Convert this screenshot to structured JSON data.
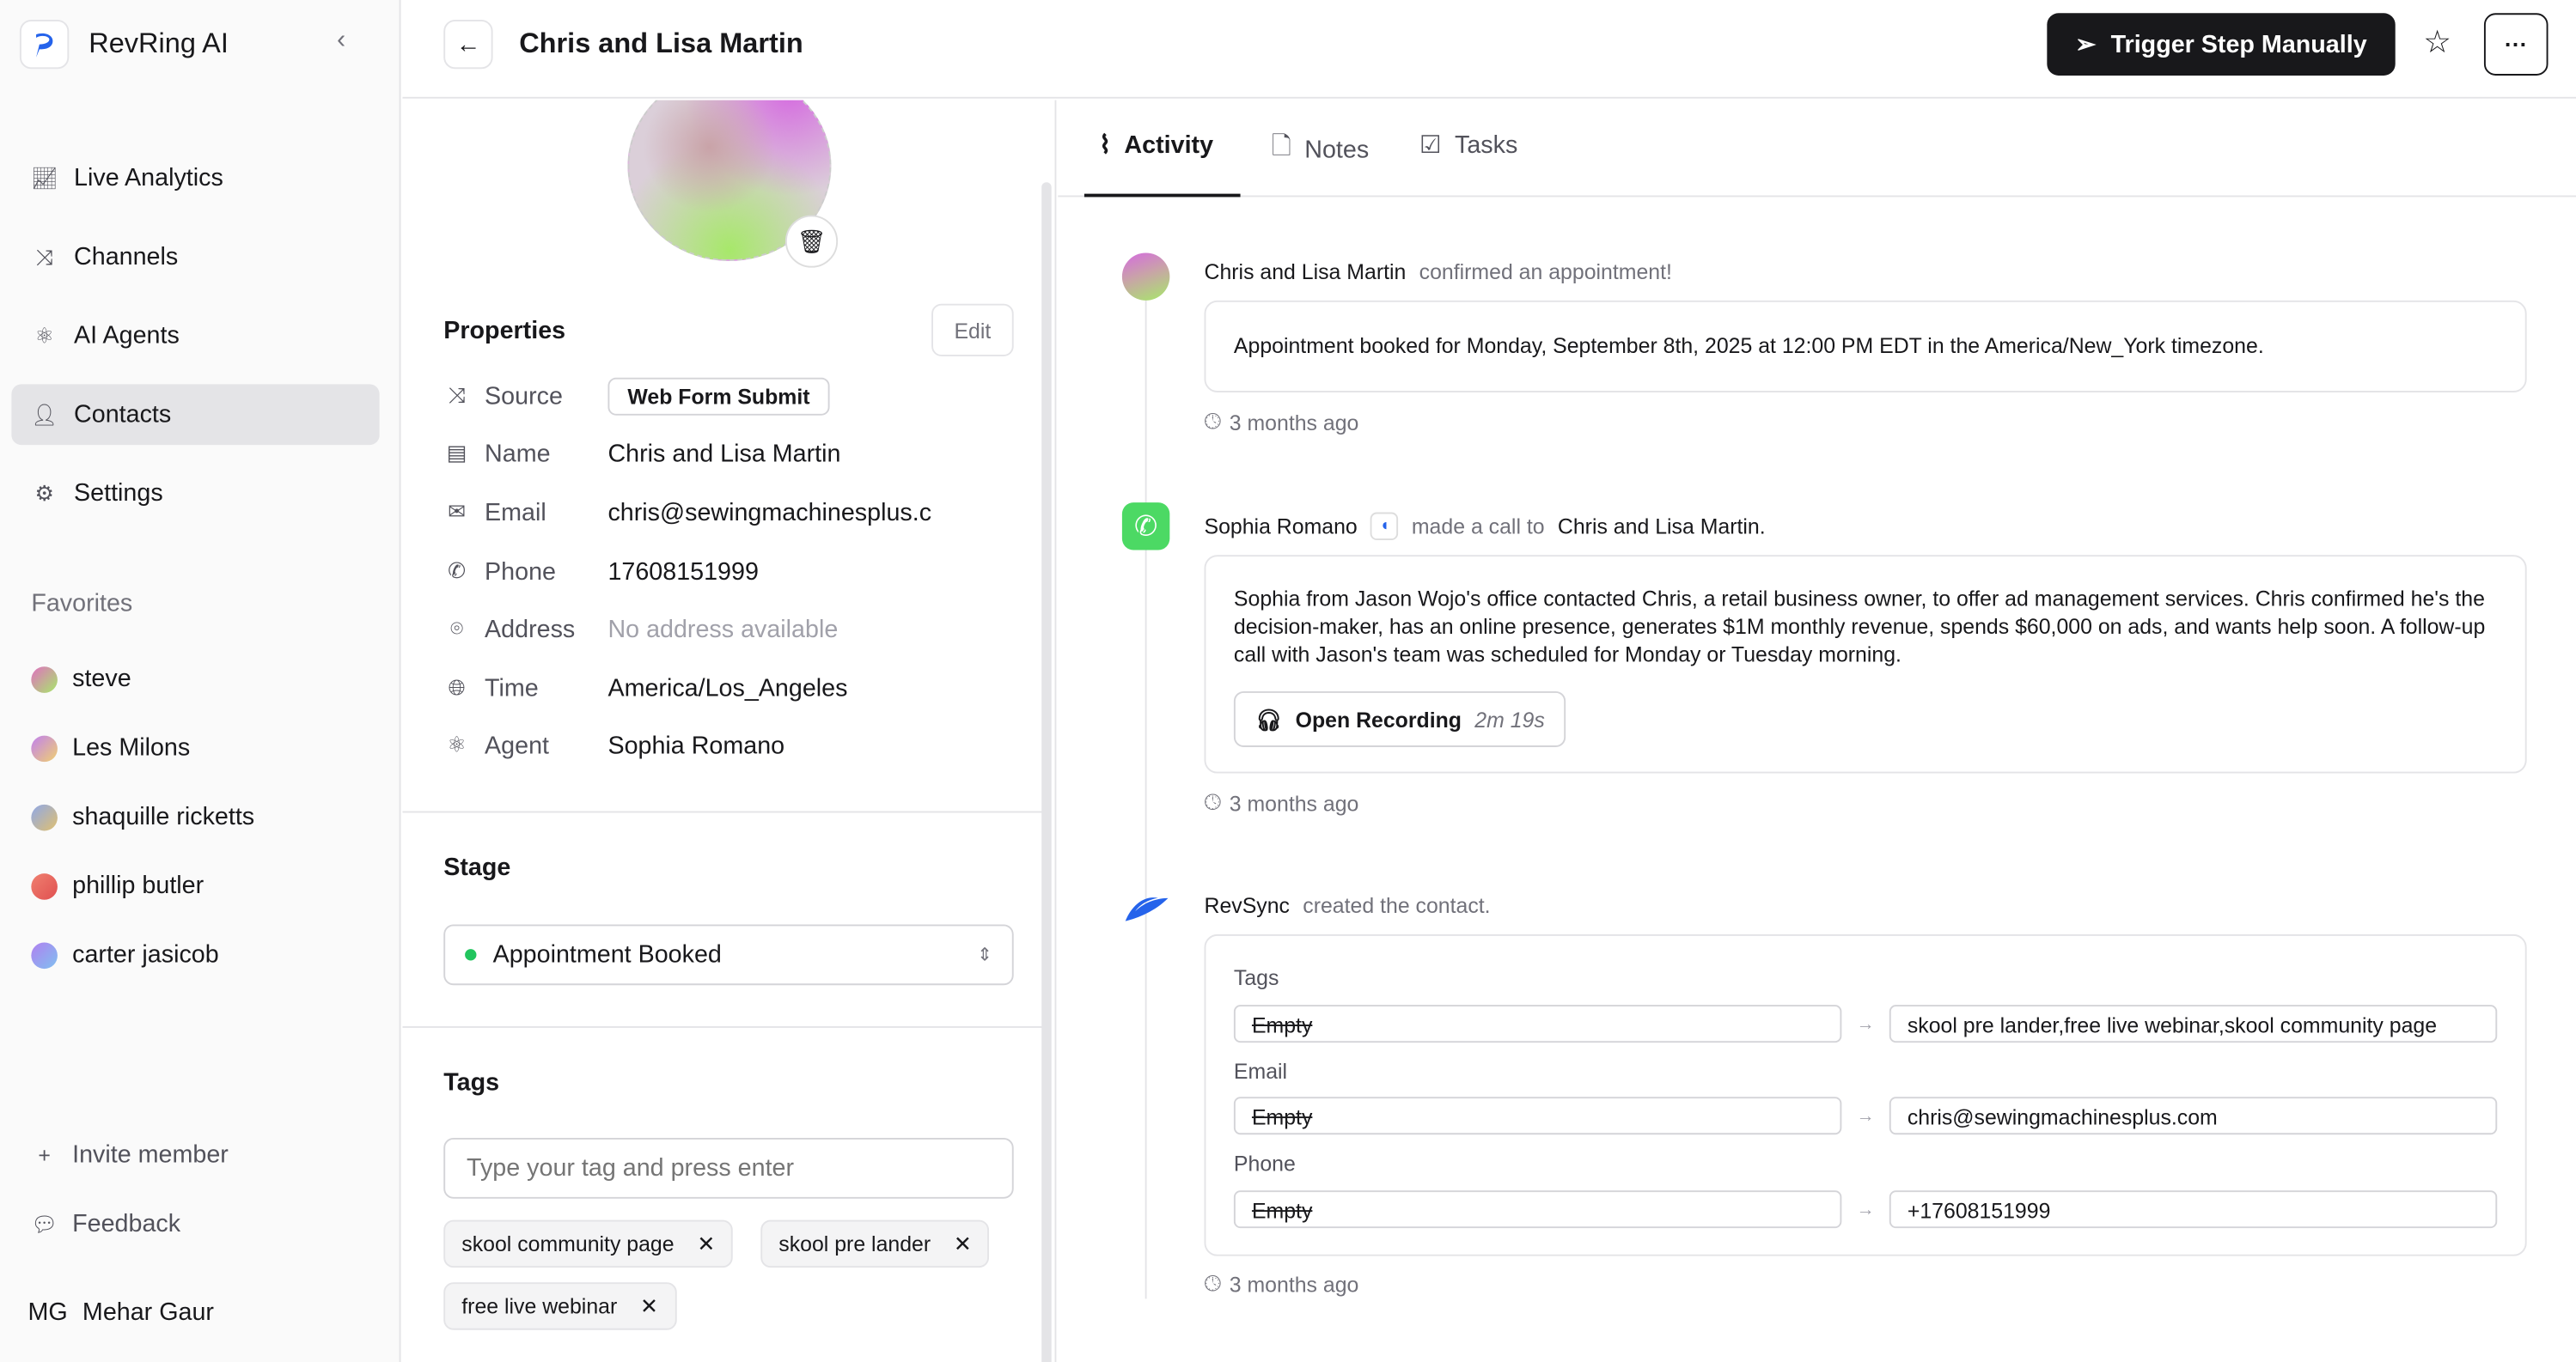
{
  "sidebar": {
    "brand": "RevRing AI",
    "nav": [
      {
        "label": "Live Analytics",
        "icon": "chart-icon"
      },
      {
        "label": "Channels",
        "icon": "shuffle-icon"
      },
      {
        "label": "AI Agents",
        "icon": "atom-icon"
      },
      {
        "label": "Contacts",
        "icon": "user-icon",
        "active": true
      },
      {
        "label": "Settings",
        "icon": "gear-icon"
      }
    ],
    "favorites_title": "Favorites",
    "favorites": [
      {
        "name": "steve",
        "color": "#a7e86a"
      },
      {
        "name": "Les Milons",
        "color": "#f0a0c8"
      },
      {
        "name": "shaquille ricketts",
        "color": "#8fa8e8"
      },
      {
        "name": "phillip butler",
        "color": "#f08070"
      },
      {
        "name": "carter jasicob",
        "color": "#b080f0"
      }
    ],
    "invite": "Invite member",
    "feedback": "Feedback",
    "user_initials": "MG",
    "user_name": "Mehar Gaur"
  },
  "header": {
    "title": "Chris and Lisa Martin",
    "trigger": "Trigger Step Manually",
    "more": "···"
  },
  "properties": {
    "title": "Properties",
    "edit": "Edit",
    "rows": [
      {
        "label": "Source",
        "value": "Web Form Submit"
      },
      {
        "label": "Name",
        "value": "Chris and Lisa Martin"
      },
      {
        "label": "Email",
        "value": "chris@sewingmachinesplus.c"
      },
      {
        "label": "Phone",
        "value": "17608151999"
      },
      {
        "label": "Address",
        "value": "No address available"
      },
      {
        "label": "Time",
        "value": "America/Los_Angeles"
      },
      {
        "label": "Agent",
        "value": "Sophia Romano"
      }
    ]
  },
  "stage": {
    "title": "Stage",
    "value": "Appointment Booked",
    "color": "#22c55e"
  },
  "tags": {
    "title": "Tags",
    "placeholder": "Type your tag and press enter",
    "items": [
      "skool community page",
      "skool pre lander",
      "free live webinar"
    ]
  },
  "tabs": [
    "Activity",
    "Notes",
    "Tasks"
  ],
  "activity": [
    {
      "actor": "Chris and Lisa Martin",
      "action": "confirmed an appointment!",
      "body": "Appointment booked for Monday, September 8th, 2025 at 12:00 PM EDT in the America/New_York timezone.",
      "ago": "3 months ago"
    },
    {
      "actor": "Sophia Romano",
      "action": "made a call to",
      "target": "Chris and Lisa Martin.",
      "body": "Sophia from Jason Wojo's office contacted Chris, a retail business owner, to offer ad management services. Chris confirmed he's the decision-maker, has an online presence, generates $1M monthly revenue, spends $60,000 on ads, and wants help soon. A follow-up call with Jason's team was scheduled for Monday or Tuesday morning.",
      "recording": "Open Recording",
      "duration": "2m 19s",
      "ago": "3 months ago"
    },
    {
      "actor": "RevSync",
      "action": "created the contact.",
      "changes": [
        {
          "field": "Tags",
          "old": "Empty",
          "new": "skool pre lander,free live webinar,skool community page"
        },
        {
          "field": "Email",
          "old": "Empty",
          "new": "chris@sewingmachinesplus.com"
        },
        {
          "field": "Phone",
          "old": "Empty",
          "new": "+17608151999"
        }
      ],
      "ago": "3 months ago"
    }
  ]
}
